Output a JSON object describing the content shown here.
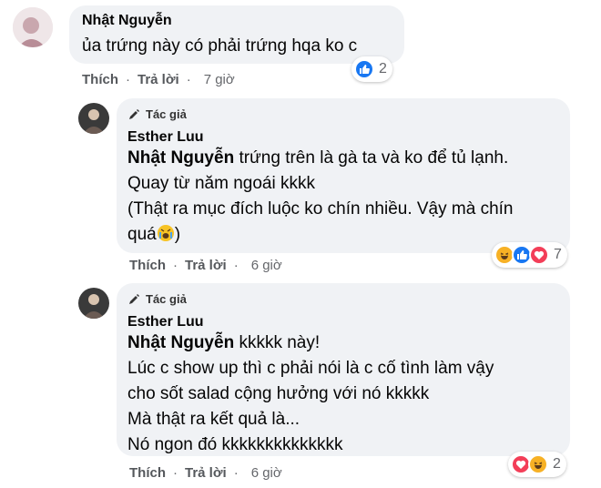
{
  "comments": [
    {
      "name": "Nhật Nguyễn",
      "text": "ủa trứng này có phải trứng hqa ko c",
      "like_label": "Thích",
      "reply_label": "Trả lời",
      "time": "7 giờ",
      "reaction_count": "2"
    },
    {
      "badge": "Tác giả",
      "name": "Esther Luu",
      "mention": "Nhật Nguyễn",
      "line1": " trứng trên là gà ta và ko để tủ lạnh.",
      "line2": "Quay từ năm ngoái kkkk",
      "line3": "(Thật ra mục đích luộc ko chín nhiều. Vậy mà chín",
      "line4": "quá",
      "line4_end": ")",
      "like_label": "Thích",
      "reply_label": "Trả lời",
      "time": "6 giờ",
      "reaction_count": "7"
    },
    {
      "badge": "Tác giả",
      "name": "Esther Luu",
      "mention": "Nhật Nguyễn",
      "line1": " kkkkk này!",
      "line2": "Lúc c show up thì c phải nói là c cố tình làm vậy",
      "line3": "cho sốt salad cộng hưởng với nó kkkkk",
      "line4": "Mà thật ra kết quả là...",
      "line5": "Nó ngon đó kkkkkkkkkkkkkk",
      "like_label": "Thích",
      "reply_label": "Trả lời",
      "time": "6 giờ",
      "reaction_count": "2"
    }
  ],
  "colors": {
    "like": "#1877f2",
    "love": "#f33e58",
    "haha": "#f7b125"
  }
}
